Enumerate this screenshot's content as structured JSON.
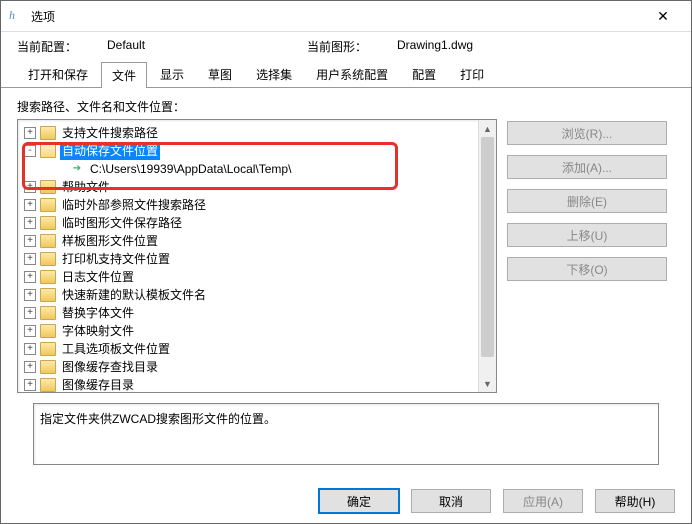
{
  "window": {
    "title": "选项",
    "close_glyph": "✕"
  },
  "info": {
    "config_label": "当前配置：",
    "config_value": "Default",
    "drawing_label": "当前图形：",
    "drawing_value": "Drawing1.dwg"
  },
  "tabs": {
    "items": [
      {
        "label": "打开和保存"
      },
      {
        "label": "文件"
      },
      {
        "label": "显示"
      },
      {
        "label": "草图"
      },
      {
        "label": "选择集"
      },
      {
        "label": "用户系统配置"
      },
      {
        "label": "配置"
      },
      {
        "label": "打印"
      }
    ],
    "active_index": 1
  },
  "section_label": "搜索路径、文件名和文件位置：",
  "tree": [
    {
      "exp": "+",
      "label": "支持文件搜索路径"
    },
    {
      "exp": "-",
      "label": "自动保存文件位置",
      "selected": true
    },
    {
      "exp": "",
      "label": "C:\\Users\\19939\\AppData\\Local\\Temp\\",
      "child": true,
      "leaf": true
    },
    {
      "exp": "+",
      "label": "帮助文件"
    },
    {
      "exp": "+",
      "label": "临时外部参照文件搜索路径"
    },
    {
      "exp": "+",
      "label": "临时图形文件保存路径"
    },
    {
      "exp": "+",
      "label": "样板图形文件位置"
    },
    {
      "exp": "+",
      "label": "打印机支持文件位置"
    },
    {
      "exp": "+",
      "label": "日志文件位置"
    },
    {
      "exp": "+",
      "label": "快速新建的默认模板文件名"
    },
    {
      "exp": "+",
      "label": "替换字体文件"
    },
    {
      "exp": "+",
      "label": "字体映射文件"
    },
    {
      "exp": "+",
      "label": "工具选项板文件位置"
    },
    {
      "exp": "+",
      "label": "图像缓存查找目录"
    },
    {
      "exp": "+",
      "label": "图像缓存目录"
    }
  ],
  "side_buttons": {
    "browse": "浏览(R)...",
    "add": "添加(A)...",
    "remove": "删除(E)",
    "up": "上移(U)",
    "down": "下移(O)"
  },
  "description": "指定文件夹供ZWCAD搜索图形文件的位置。",
  "footer": {
    "ok": "确定",
    "cancel": "取消",
    "apply": "应用(A)",
    "help": "帮助(H)"
  }
}
